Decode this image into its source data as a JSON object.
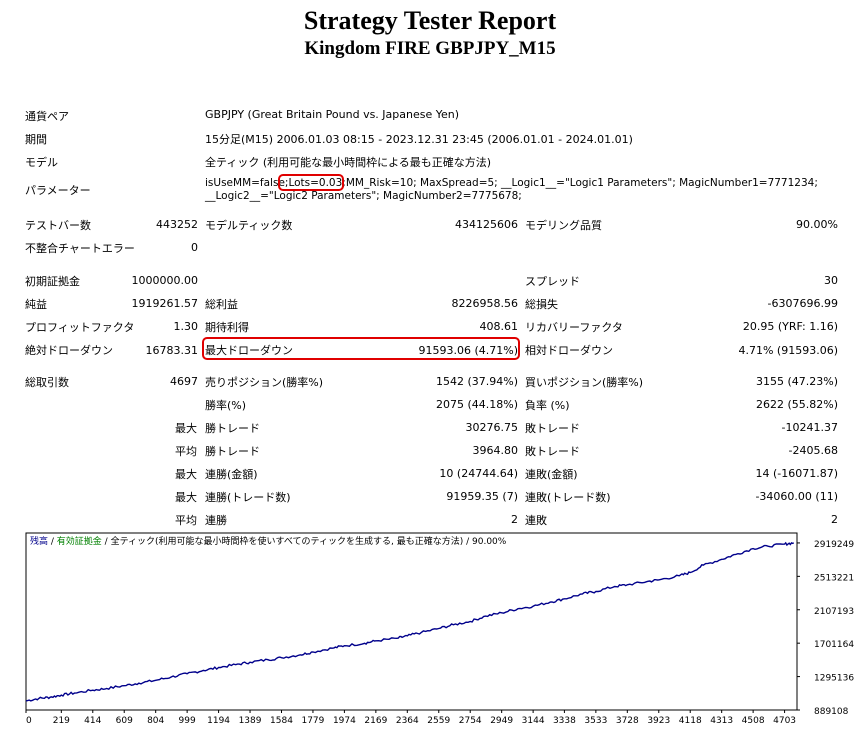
{
  "report": {
    "title": "Strategy Tester Report",
    "subtitle": "Kingdom FIRE GBPJPY_M15"
  },
  "info": {
    "symbol_label": "通貨ペア",
    "symbol_value": "GBPJPY (Great Britain Pound vs. Japanese Yen)",
    "period_label": "期間",
    "period_value": "15分足(M15) 2006.01.03 08:15 - 2023.12.31 23:45 (2006.01.01 - 2024.01.01)",
    "model_label": "モデル",
    "model_value": "全ティック (利用可能な最小時間枠による最も正確な方法)",
    "params_label": "パラメーター",
    "params_line1_a": "isUseMM=false;",
    "params_line1_b": "Lots=0.03;",
    "params_line1_c": "MM_Risk=10; MaxSpread=5; __Logic1__=\"Logic1 Parameters\"; MagicNumber1=7771234;",
    "params_line2": "__Logic2__=\"Logic2 Parameters\"; MagicNumber2=7775678;"
  },
  "stats": {
    "bars_label": "テストバー数",
    "bars_value": "443252",
    "ticks_label": "モデルティック数",
    "ticks_value": "434125606",
    "quality_label": "モデリング品質",
    "quality_value": "90.00%",
    "errors_label": "不整合チャートエラー",
    "errors_value": "0",
    "deposit_label": "初期証拠金",
    "deposit_value": "1000000.00",
    "spread_label": "スプレッド",
    "spread_value": "30",
    "net_label": "純益",
    "net_value": "1919261.57",
    "gross_profit_label": "総利益",
    "gross_profit_value": "8226958.56",
    "gross_loss_label": "総損失",
    "gross_loss_value": "-6307696.99",
    "pf_label": "プロフィットファクタ",
    "pf_value": "1.30",
    "expected_label": "期待利得",
    "expected_value": "408.61",
    "recovery_label": "リカバリーファクタ",
    "recovery_value": "20.95 (YRF: 1.16)",
    "abs_dd_label": "絶対ドローダウン",
    "abs_dd_value": "16783.31",
    "max_dd_label": "最大ドローダウン",
    "max_dd_value": "91593.06 (4.71%)",
    "rel_dd_label": "相対ドローダウン",
    "rel_dd_value": "4.71% (91593.06)",
    "total_trades_label": "総取引数",
    "total_trades_value": "4697",
    "short_label": "売りポジション(勝率%)",
    "short_value": "1542 (37.94%)",
    "long_label": "買いポジション(勝率%)",
    "long_value": "3155 (47.23%)",
    "win_rate_label": "勝率(%)",
    "win_rate_value": "2075 (44.18%)",
    "loss_rate_label": "負率 (%)",
    "loss_rate_value": "2622 (55.82%)",
    "max_word": "最大",
    "avg_word": "平均",
    "largest_win_label": "勝トレード",
    "largest_win_value": "30276.75",
    "largest_loss_label": "敗トレード",
    "largest_loss_value": "-10241.37",
    "avg_win_label": "勝トレード",
    "avg_win_value": "3964.80",
    "avg_loss_label": "敗トレード",
    "avg_loss_value": "-2405.68",
    "cons_wins_amt_label": "連勝(金額)",
    "cons_wins_amt_value": "10 (24744.64)",
    "cons_losses_amt_label": "連敗(金額)",
    "cons_losses_amt_value": "14 (-16071.87)",
    "cons_wins_trd_label": "連勝(トレード数)",
    "cons_wins_trd_value": "91959.35 (7)",
    "cons_losses_trd_label": "連敗(トレード数)",
    "cons_losses_trd_value": "-34060.00 (11)",
    "avg_cons_wins_label": "連勝",
    "avg_cons_wins_value": "2",
    "avg_cons_losses_label": "連敗",
    "avg_cons_losses_value": "2"
  },
  "legend": {
    "balance": "残高",
    "sep": " / ",
    "equity": "有効証拠金",
    "model": "全ティック(利用可能な最小時間枠を使いすべてのティックを生成する, 最も正確な方法)",
    "quality": "90.00%"
  },
  "colors": {
    "highlight": "#e00000",
    "balance_line": "#00008b",
    "equity_legend": "#008000",
    "legend_text": "#00008b"
  },
  "chart_data": {
    "type": "line",
    "x_ticks": [
      0,
      219,
      414,
      609,
      804,
      999,
      1194,
      1389,
      1584,
      1779,
      1974,
      2169,
      2364,
      2559,
      2754,
      2949,
      3144,
      3338,
      3533,
      3728,
      3923,
      4118,
      4313,
      4508,
      4703
    ],
    "y_ticks": [
      889108,
      1295136,
      1701164,
      2107193,
      2513221,
      2919249
    ],
    "xlim": [
      0,
      4780
    ],
    "ylim": [
      889108,
      3040000
    ],
    "series": [
      {
        "values": [
          [
            0,
            1000000
          ],
          [
            80,
            1030000
          ],
          [
            150,
            1045000
          ],
          [
            219,
            1070000
          ],
          [
            300,
            1095000
          ],
          [
            414,
            1130000
          ],
          [
            500,
            1150000
          ],
          [
            609,
            1185000
          ],
          [
            700,
            1215000
          ],
          [
            804,
            1250000
          ],
          [
            900,
            1290000
          ],
          [
            999,
            1330000
          ],
          [
            1100,
            1370000
          ],
          [
            1194,
            1405000
          ],
          [
            1300,
            1440000
          ],
          [
            1389,
            1470000
          ],
          [
            1500,
            1500000
          ],
          [
            1584,
            1525000
          ],
          [
            1700,
            1560000
          ],
          [
            1779,
            1595000
          ],
          [
            1900,
            1640000
          ],
          [
            1974,
            1670000
          ],
          [
            2100,
            1700000
          ],
          [
            2169,
            1730000
          ],
          [
            2300,
            1760000
          ],
          [
            2364,
            1790000
          ],
          [
            2450,
            1830000
          ],
          [
            2559,
            1880000
          ],
          [
            2650,
            1925000
          ],
          [
            2754,
            1965000
          ],
          [
            2850,
            2030000
          ],
          [
            2949,
            2070000
          ],
          [
            3050,
            2120000
          ],
          [
            3144,
            2150000
          ],
          [
            3250,
            2200000
          ],
          [
            3338,
            2240000
          ],
          [
            3450,
            2300000
          ],
          [
            3533,
            2330000
          ],
          [
            3650,
            2390000
          ],
          [
            3728,
            2410000
          ],
          [
            3850,
            2450000
          ],
          [
            3923,
            2470000
          ],
          [
            4050,
            2520000
          ],
          [
            4118,
            2560000
          ],
          [
            4200,
            2650000
          ],
          [
            4313,
            2720000
          ],
          [
            4400,
            2780000
          ],
          [
            4508,
            2850000
          ],
          [
            4600,
            2880000
          ],
          [
            4703,
            2905000
          ],
          [
            4760,
            2919249
          ]
        ]
      }
    ]
  }
}
